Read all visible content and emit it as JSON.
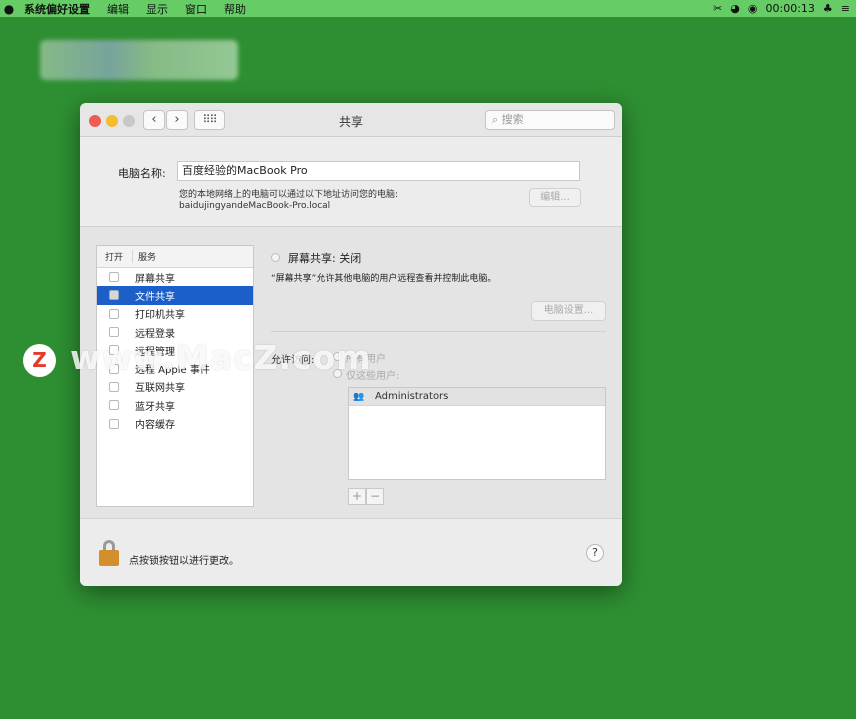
{
  "menubar": {
    "app": "系统偏好设置",
    "items": [
      "编辑",
      "显示",
      "窗口",
      "帮助"
    ],
    "clock": "00:00:13"
  },
  "window": {
    "title": "共享",
    "search_placeholder": "搜索",
    "computer_name_label": "电脑名称:",
    "computer_name": "百度经验的MacBook Pro",
    "local_hint": "您的本地网络上的电脑可以通过以下地址访问您的电脑:",
    "local_address": "baidujingyandeMacBook-Pro.local",
    "edit_button": "编辑..."
  },
  "services": {
    "col_on": "打开",
    "col_service": "服务",
    "items": [
      {
        "label": "屏幕共享",
        "checked": false,
        "selected": false
      },
      {
        "label": "文件共享",
        "checked": false,
        "selected": true
      },
      {
        "label": "打印机共享",
        "checked": false,
        "selected": false
      },
      {
        "label": "远程登录",
        "checked": false,
        "selected": false
      },
      {
        "label": "远程管理",
        "checked": false,
        "selected": false
      },
      {
        "label": "远程 Apple 事件",
        "checked": false,
        "selected": false
      },
      {
        "label": "互联网共享",
        "checked": false,
        "selected": false
      },
      {
        "label": "蓝牙共享",
        "checked": false,
        "selected": false
      },
      {
        "label": "内容缓存",
        "checked": false,
        "selected": false
      }
    ]
  },
  "detail": {
    "status": "屏幕共享: 关闭",
    "description": "“屏幕共享”允许其他电脑的用户远程查看并控制此电脑。",
    "computer_settings_button": "电脑设置...",
    "allow_access_label": "允许访问:",
    "radio_all_users": "所有用户",
    "radio_these_users": "仅这些用户:",
    "users": [
      "Administrators"
    ],
    "add_button": "+",
    "remove_button": "−"
  },
  "footer": {
    "lock_text": "点按锁按钮以进行更改。",
    "help": "?"
  },
  "watermark": {
    "logo_letter": "Z",
    "text": "www.MacZ.com"
  },
  "colors": {
    "desktop": "#2e8f32",
    "menubar": "#66cc66",
    "selection": "#1c5fc8"
  }
}
